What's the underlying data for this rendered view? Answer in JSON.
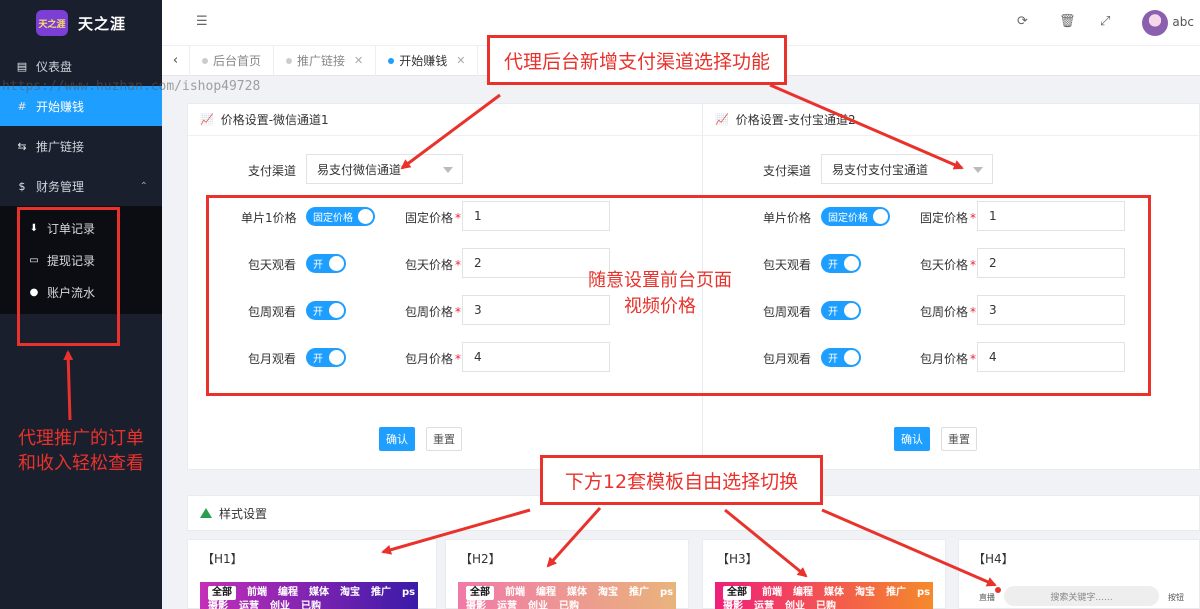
{
  "sidebar": {
    "logo_badge": "天之涯",
    "logo_title": "天之涯",
    "items": [
      {
        "label": "仪表盘",
        "icon": "dashboard-icon"
      },
      {
        "label": "开始赚钱",
        "icon": "hash-icon"
      },
      {
        "label": "推广链接",
        "icon": "usb-icon"
      },
      {
        "label": "财务管理",
        "icon": "dollar-icon"
      }
    ],
    "sub_items": [
      {
        "label": "订单记录",
        "icon": "download-icon"
      },
      {
        "label": "提现记录",
        "icon": "card-icon"
      },
      {
        "label": "账户流水",
        "icon": "arrow-circle-icon"
      }
    ]
  },
  "topbar": {
    "username": "abc"
  },
  "tabs": [
    {
      "label": "后台首页"
    },
    {
      "label": "推广链接"
    },
    {
      "label": "开始赚钱"
    }
  ],
  "watermark": "https://www.huzhan.com/ishop49728",
  "wechat_panel": {
    "title": "价格设置-微信通道1",
    "channel_label": "支付渠道",
    "channel_value": "易支付微信通道",
    "rows": [
      {
        "label": "单片1价格",
        "switch": "固定价格",
        "price_label": "固定价格",
        "price": "1"
      },
      {
        "label": "包天观看",
        "switch": "开",
        "price_label": "包天价格",
        "price": "2"
      },
      {
        "label": "包周观看",
        "switch": "开",
        "price_label": "包周价格",
        "price": "3"
      },
      {
        "label": "包月观看",
        "switch": "开",
        "price_label": "包月价格",
        "price": "4"
      }
    ],
    "confirm": "确认",
    "reset": "重置"
  },
  "alipay_panel": {
    "title": "价格设置-支付宝通道2",
    "channel_label": "支付渠道",
    "channel_value": "易支付支付宝通道",
    "rows": [
      {
        "label": "单片价格",
        "switch": "固定价格",
        "price_label": "固定价格",
        "price": "1"
      },
      {
        "label": "包天观看",
        "switch": "开",
        "price_label": "包天价格",
        "price": "2"
      },
      {
        "label": "包周观看",
        "switch": "开",
        "price_label": "包周价格",
        "price": "3"
      },
      {
        "label": "包月观看",
        "switch": "开",
        "price_label": "包月价格",
        "price": "4"
      }
    ],
    "confirm": "确认",
    "reset": "重置"
  },
  "style_panel": {
    "title": "样式设置"
  },
  "templates": [
    {
      "title": "【H1】",
      "tags": [
        "全部",
        "前端",
        "编程",
        "媒体",
        "淘宝",
        "推广",
        "ps",
        "摄影",
        "运营",
        "创业",
        "已购"
      ]
    },
    {
      "title": "【H2】",
      "tags": [
        "全部",
        "前端",
        "编程",
        "媒体",
        "淘宝",
        "推广",
        "ps",
        "摄影",
        "运营",
        "创业",
        "已购"
      ]
    },
    {
      "title": "【H3】",
      "tags": [
        "全部",
        "前端",
        "编程",
        "媒体",
        "淘宝",
        "推广",
        "ps",
        "摄影",
        "运营",
        "创业",
        "已购"
      ]
    },
    {
      "title": "【H4】",
      "left": "直播",
      "search": "搜索关键字......",
      "right": "按钮"
    }
  ],
  "annotations": {
    "top": "代理后台新增支付渠道选择功能",
    "middle_line1": "随意设置前台页面",
    "middle_line2": "视频价格",
    "left_line1": "代理推广的订单",
    "left_line2": "和收入轻松查看",
    "bottom": "下方12套模板自由选择切换"
  },
  "colors": {
    "accent": "#1e9fff",
    "sidebar_bg": "#191f2d",
    "annotation_red": "#e8322b"
  }
}
